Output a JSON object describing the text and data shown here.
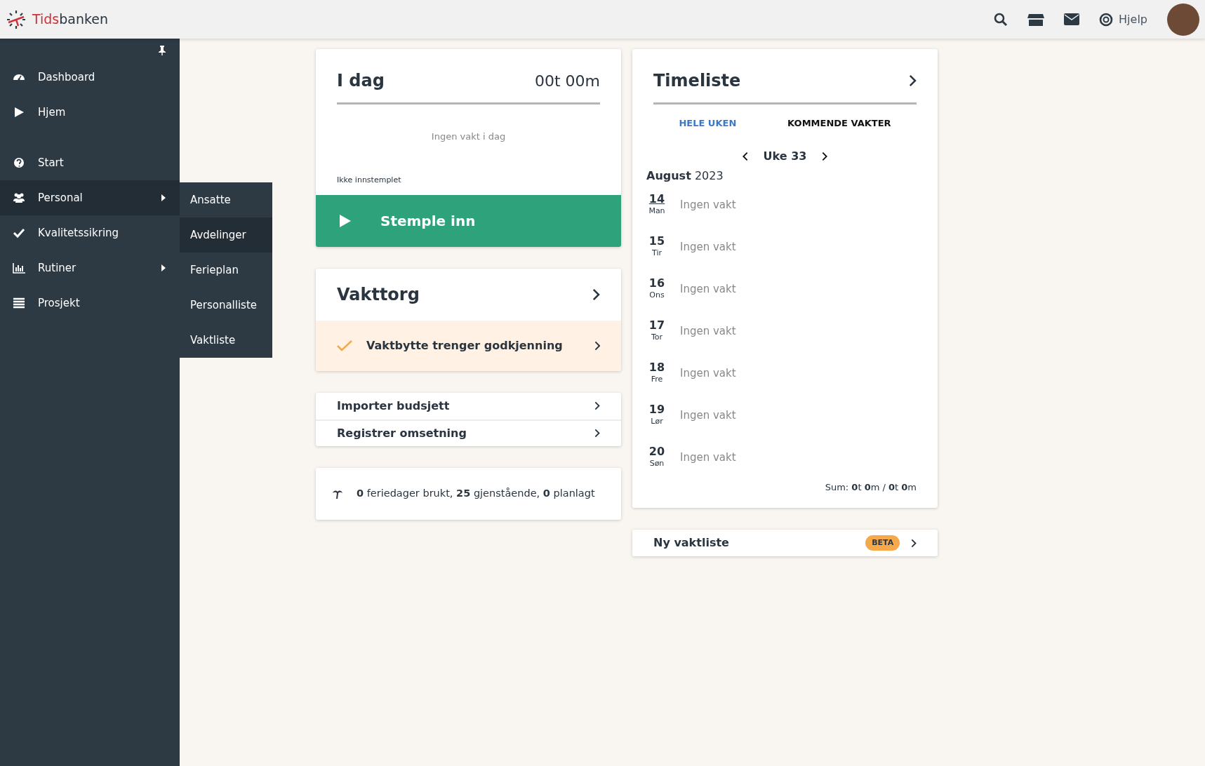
{
  "topbar": {
    "brand_first": "Tids",
    "brand_second": "banken",
    "help": "Hjelp"
  },
  "sidebar": {
    "items": [
      {
        "label": "Dashboard",
        "has_submenu": false,
        "selected": false
      },
      {
        "label": "Hjem",
        "has_submenu": false,
        "selected": false
      },
      {
        "label": "Start",
        "has_submenu": false,
        "selected": false
      },
      {
        "label": "Personal",
        "has_submenu": true,
        "selected": true
      },
      {
        "label": "Kvalitetssikring",
        "has_submenu": false,
        "selected": false
      },
      {
        "label": "Rutiner",
        "has_submenu": true,
        "selected": false
      },
      {
        "label": "Prosjekt",
        "has_submenu": false,
        "selected": false
      }
    ],
    "submenu": [
      {
        "label": "Ansatte",
        "selected": false
      },
      {
        "label": "Avdelinger",
        "selected": true
      },
      {
        "label": "Ferieplan",
        "selected": false
      },
      {
        "label": "Personalliste",
        "selected": false
      },
      {
        "label": "Vaktliste",
        "selected": false
      }
    ]
  },
  "today_card": {
    "title": "I dag",
    "time": "00t 00m",
    "empty": "Ingen vakt i dag",
    "status": "Ikke innstemplet",
    "button": "Stemple inn"
  },
  "vakttorg": {
    "title": "Vakttorg",
    "notice": "Vaktbytte trenger godkjenning"
  },
  "links": [
    "Importer budsjett",
    "Registrer omsetning"
  ],
  "vacation": "**0** feriedager brukt, **25** gjenstående, **0** planlagt",
  "timeliste": {
    "title": "Timeliste",
    "tabs": [
      {
        "label": "HELE UKEN",
        "selected": true
      },
      {
        "label": "KOMMENDE VAKTER",
        "selected": false
      }
    ],
    "week": "Uke 33",
    "month": "**August** 2023",
    "days": [
      {
        "date": "14",
        "weekday": "Man",
        "text": "Ingen vakt",
        "today": true
      },
      {
        "date": "15",
        "weekday": "Tir",
        "text": "Ingen vakt",
        "today": false
      },
      {
        "date": "16",
        "weekday": "Ons",
        "text": "Ingen vakt",
        "today": false
      },
      {
        "date": "17",
        "weekday": "Tor",
        "text": "Ingen vakt",
        "today": false
      },
      {
        "date": "18",
        "weekday": "Fre",
        "text": "Ingen vakt",
        "today": false
      },
      {
        "date": "19",
        "weekday": "Lør",
        "text": "Ingen vakt",
        "today": false
      },
      {
        "date": "20",
        "weekday": "Søn",
        "text": "Ingen vakt",
        "today": false
      }
    ],
    "sum": "Sum: **0**t **0**m / **0**t **0**m"
  },
  "ny_vaktliste": {
    "title": "Ny vaktliste",
    "badge": "BETA"
  }
}
